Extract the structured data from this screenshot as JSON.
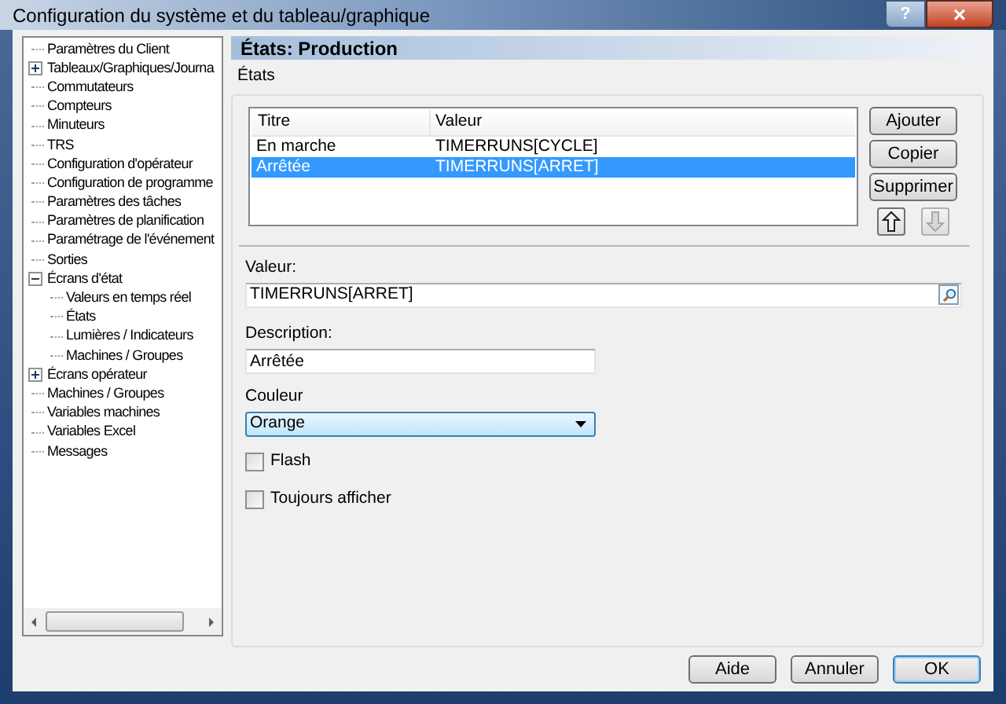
{
  "window": {
    "title": "Configuration du système et du tableau/graphique",
    "help_button": "?",
    "close_button": "×"
  },
  "tree": [
    {
      "label": "Paramètres du Client"
    },
    {
      "label": "Tableaux/Graphiques/Journa",
      "expanded": false
    },
    {
      "label": "Commutateurs"
    },
    {
      "label": "Compteurs"
    },
    {
      "label": "Minuteurs"
    },
    {
      "label": "TRS"
    },
    {
      "label": "Configuration d'opérateur"
    },
    {
      "label": "Configuration de programme"
    },
    {
      "label": "Paramètres des tâches"
    },
    {
      "label": "Paramètres de planification"
    },
    {
      "label": "Paramétrage de l'événement"
    },
    {
      "label": "Sorties"
    },
    {
      "label": "Écrans d'état",
      "expanded": true,
      "children": [
        {
          "label": "Valeurs en temps réel"
        },
        {
          "label": "États"
        },
        {
          "label": "Lumières / Indicateurs"
        },
        {
          "label": "Machines / Groupes"
        }
      ]
    },
    {
      "label": "Écrans opérateur",
      "expanded": false
    },
    {
      "label": "Machines / Groupes"
    },
    {
      "label": "Variables machines"
    },
    {
      "label": "Variables Excel"
    },
    {
      "label": "Messages"
    }
  ],
  "header": "États: Production",
  "group_label": "États",
  "table": {
    "columns": [
      "Titre",
      "Valeur"
    ],
    "rows": [
      {
        "cells": [
          "En marche",
          "TIMERRUNS[CYCLE]"
        ],
        "selected": false
      },
      {
        "cells": [
          "Arrêtée",
          "TIMERRUNS[ARRET]"
        ],
        "selected": true
      }
    ]
  },
  "side_buttons": [
    "Ajouter",
    "Copier",
    "Supprimer"
  ],
  "move_buttons": [
    {
      "kind": "up",
      "disabled": false
    },
    {
      "kind": "down",
      "disabled": true
    }
  ],
  "value": {
    "label": "Valeur:",
    "value": "TIMERRUNS[ARRET]"
  },
  "description": {
    "label": "Description:",
    "value": "Arrêtée"
  },
  "color": {
    "label": "Couleur",
    "value": "Orange"
  },
  "checkboxes": [
    {
      "label": "Flash",
      "checked": false
    },
    {
      "label": "Toujours afficher",
      "checked": false
    }
  ],
  "buttons": [
    {
      "label": "Aide",
      "default": false
    },
    {
      "label": "Annuler",
      "default": false
    },
    {
      "label": "OK",
      "default": true
    }
  ]
}
